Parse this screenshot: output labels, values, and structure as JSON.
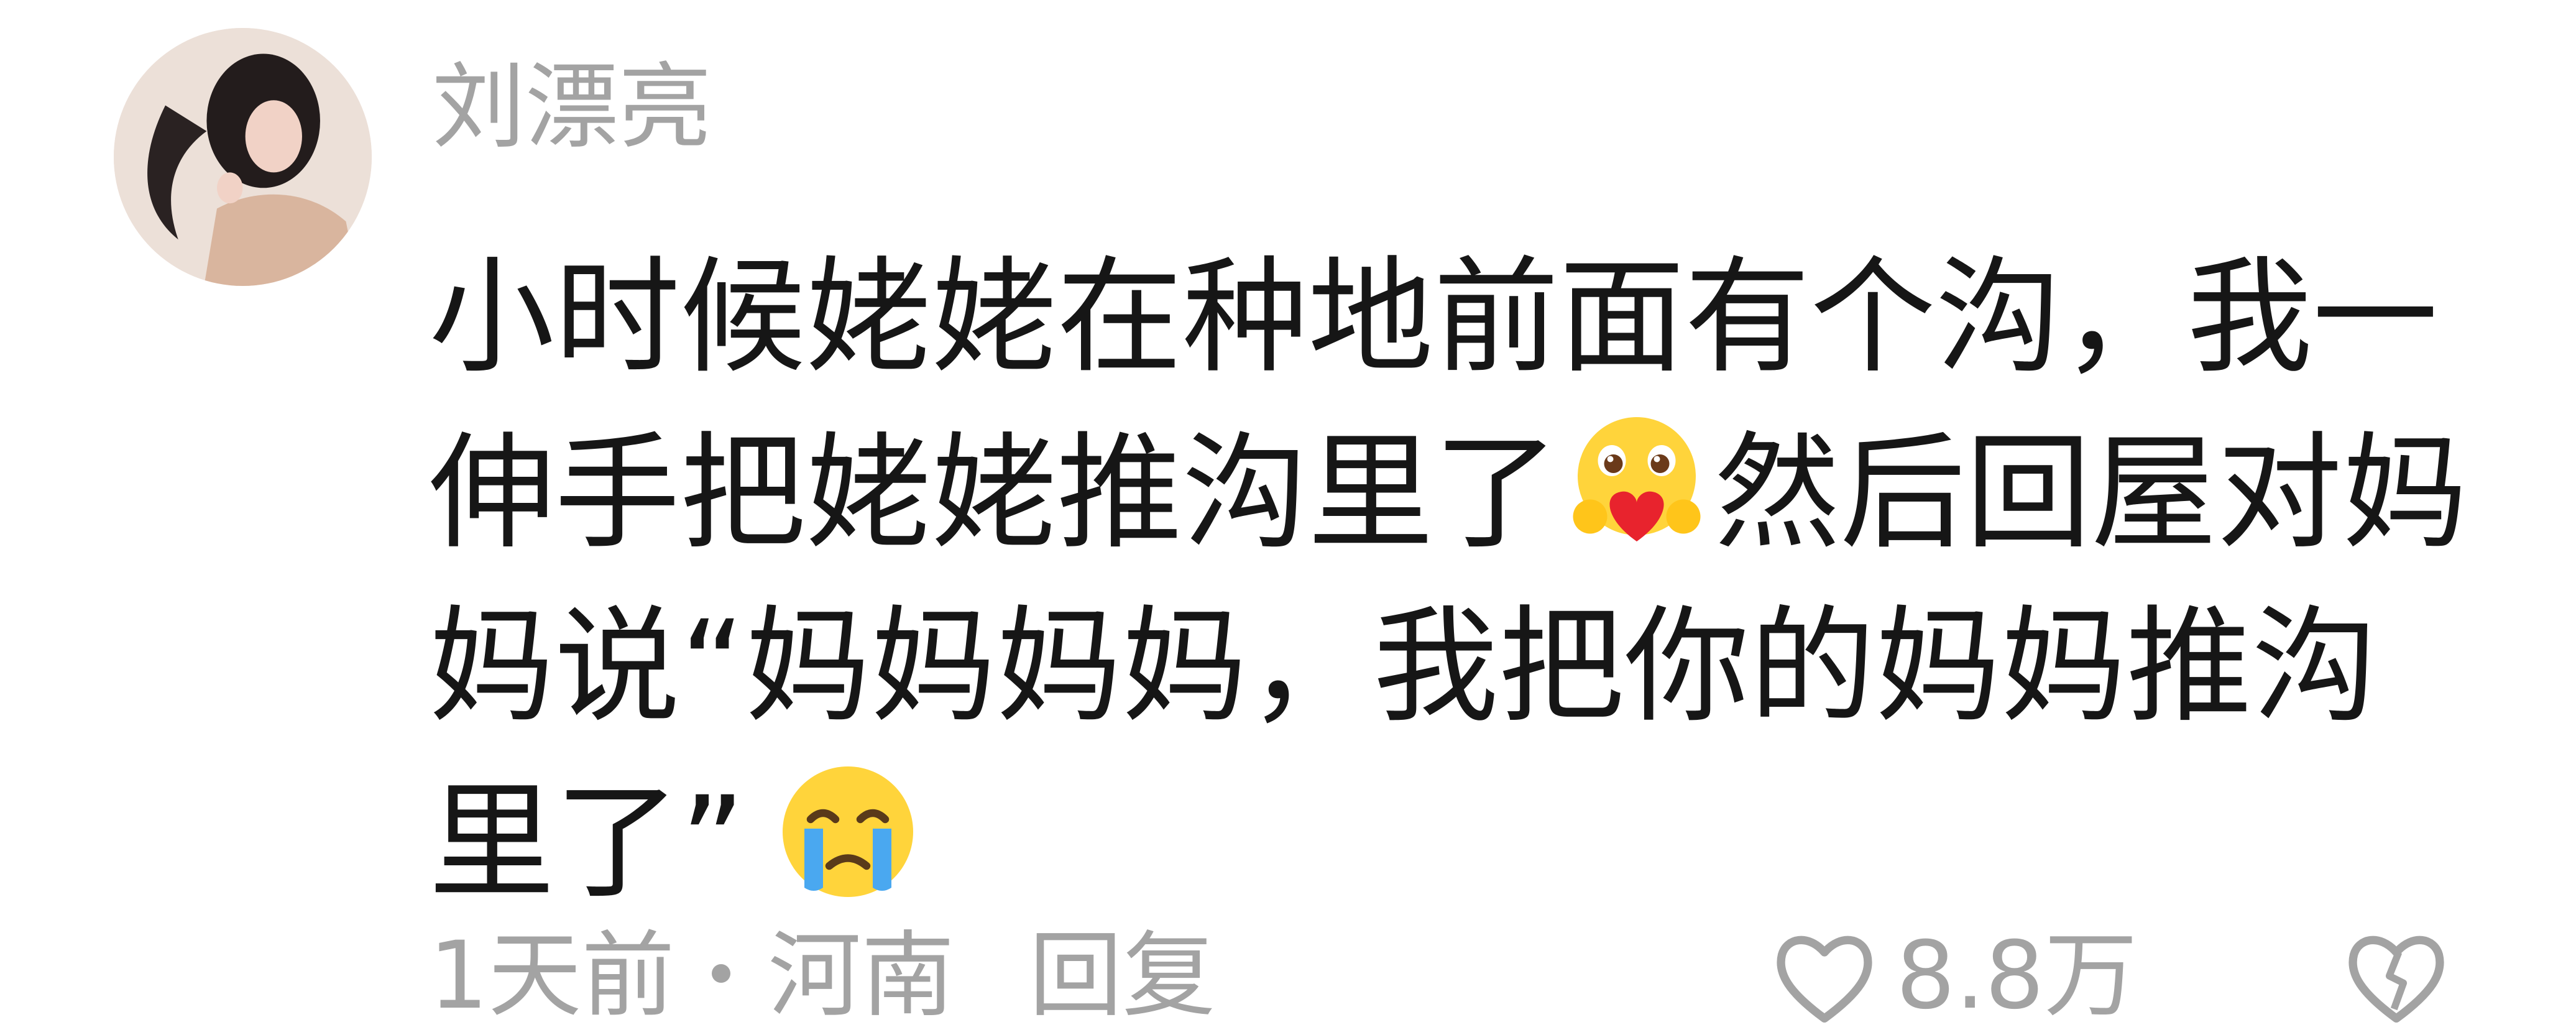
{
  "comment": {
    "author": "刘漂亮",
    "avatar_icon": "user-avatar-photo",
    "lines": [
      {
        "text": "小时候姥姥在种地前面有个沟，我一"
      },
      {
        "before": "伸手把姥姥推沟里了",
        "emoji": "heart-hug-emoji",
        "after": "然后回屋对妈"
      },
      {
        "text": "妈说“妈妈妈妈，我把你的妈妈推沟"
      },
      {
        "before": "里了”",
        "emoji": "crying-emoji"
      }
    ],
    "time": "1天前",
    "location": "河南",
    "reply_label": "回复",
    "like_count": "8.8万",
    "like_icon": "heart-outline-icon",
    "dislike_icon": "dislike-heart-icon"
  },
  "colors": {
    "text": "#161616",
    "meta": "#a3a3a3",
    "background": "#ffffff"
  }
}
